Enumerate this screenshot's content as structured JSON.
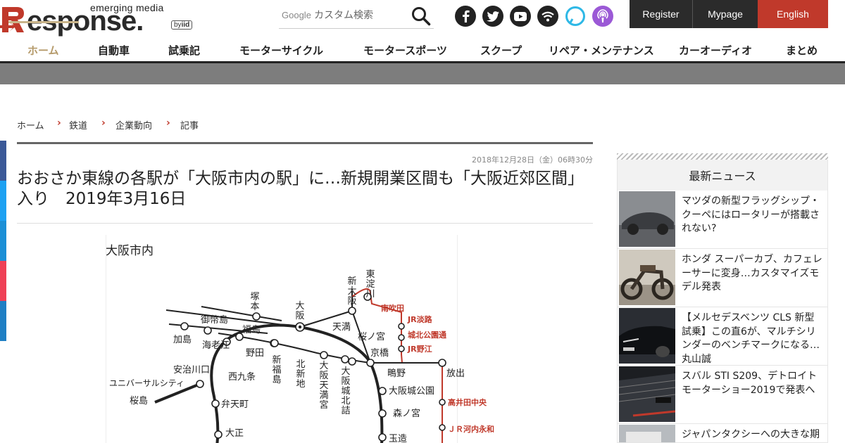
{
  "header": {
    "logo_word": "esponse.",
    "logo_tagline": "emerging media",
    "logo_by": "by",
    "logo_by_brand": "iid",
    "search_brand": "Google",
    "search_placeholder": "カスタム検索",
    "auth": {
      "register": "Register",
      "mypage": "Mypage",
      "english": "English"
    },
    "colors": {
      "accent": "#c0392b",
      "dark": "#2b2b2b",
      "nav_active": "#b59a6a"
    }
  },
  "nav": [
    "ホーム",
    "自動車",
    "試乗記",
    "モーターサイクル",
    "モータースポーツ",
    "スクープ",
    "リペア・メンテナンス",
    "カーオーディオ",
    "まとめ"
  ],
  "breadcrumb": [
    "ホーム",
    "鉄道",
    "企業動向",
    "記事"
  ],
  "breadcrumb_separator": "›",
  "article": {
    "date": "2018年12月28日（金）06時30分",
    "title": "おおさか東線の各駅が「大阪市内の駅」に…新規開業区間も「大阪近郊区間」入り　2019年3月16日",
    "map": {
      "title": "大阪市内",
      "stations": {
        "higashiyodogawa": "東淀川",
        "shinosaka": "新大阪",
        "tsukamoto": "塚本",
        "osaka": "大阪",
        "minamisuita": "南吹田",
        "jr_awaji": "JR淡路",
        "shirokita": "城北公園通",
        "jr_noe": "JR野江",
        "mitejima": "御幣島",
        "fukushima": "福島",
        "tenma": "天満",
        "sakuranomiya": "桜ノ宮",
        "kashima": "加島",
        "ebie": "海老江",
        "noda": "野田",
        "kyobashi": "京橋",
        "shinfukushima": "新福島",
        "kitashinchi": "北新地",
        "osakatenmangu": "大阪天満宮",
        "osakajokitazume": "大阪城北詰",
        "hanaten": "放出",
        "shigino": "鴫野",
        "ajikawaguchi": "安治川口",
        "nishikujo": "西九条",
        "osakajokoen": "大阪城公園",
        "universal": "ユニバーサルシティ",
        "takaidachuo": "高井田中央",
        "bentencho": "弁天町",
        "morinomiya": "森ノ宮",
        "sakurajima": "桜島",
        "jr_kawachieiwa": "ＪＲ河内永和",
        "taisho": "大正",
        "tamatsukuri": "玉造"
      }
    }
  },
  "sidebar": {
    "heading": "最新ニュース",
    "items": [
      {
        "text": "マツダの新型フラッグシップ・クーペにはロータリーが搭載されない?"
      },
      {
        "text": "ホンダ スーパーカブ、カフェレーサーに変身…カスタマイズモデル発表"
      },
      {
        "text": "【メルセデスベンツ CLS 新型試乗】この直6が、マルチシリンダーのベンチマークになる…丸山誠"
      },
      {
        "text": "スバル STI S209、デトロイトモーターショー2019で発表へ"
      },
      {
        "text": "ジャパンタクシーへの大きな期"
      }
    ]
  },
  "social_icons": [
    "facebook-icon",
    "twitter-icon",
    "youtube-icon",
    "rss-icon",
    "alexa-icon",
    "podcast-icon"
  ]
}
